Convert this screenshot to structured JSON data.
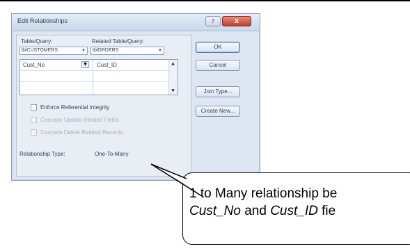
{
  "dialog": {
    "title": "Edit Relationships",
    "help_button": "?",
    "close_button": "X",
    "table_query_label": "Table/Query:",
    "related_table_query_label": "Related Table/Query:",
    "table_query_value": "tblCUSTOMERS",
    "related_table_query_value": "tblORDERS",
    "rows": [
      {
        "left": "Cust_No",
        "right": "Cust_ID"
      }
    ],
    "enforce_integrity_label": "Enforce Referential Integrity",
    "cascade_update_label": "Cascade Update Related Fields",
    "cascade_delete_label": "Cascade Delete Related Records",
    "relationship_type_label": "Relationship Type:",
    "relationship_type_value": "One-To-Many",
    "buttons": {
      "ok": "OK",
      "cancel": "Cancel",
      "join_type": "Join Type...",
      "create_new": "Create New..."
    }
  },
  "callout": {
    "line1": "1 to Many relationship be",
    "line2_field1": "Cust_No",
    "line2_and": " and ",
    "line2_field2": "Cust_ID",
    "line2_tail": " fie"
  },
  "colors": {
    "dialog_bg": "#dde6f1",
    "title_text": "#2b3f5f",
    "close_button": "#c3402b"
  }
}
